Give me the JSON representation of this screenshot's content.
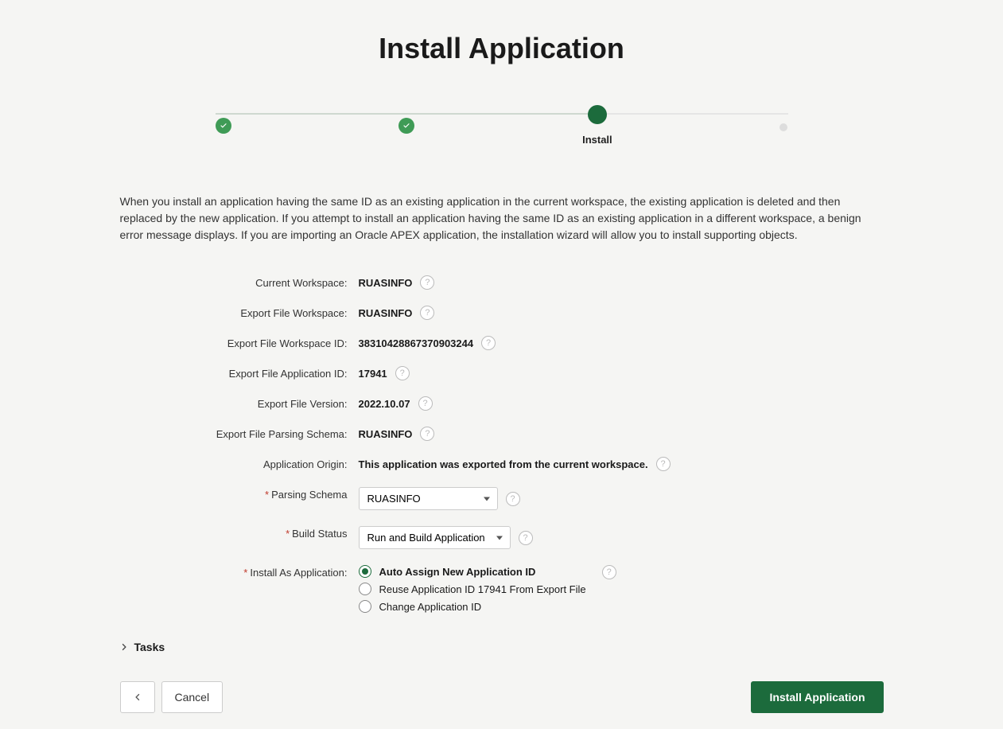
{
  "page_title": "Install Application",
  "steps": {
    "current_label": "Install"
  },
  "intro": "When you install an application having the same ID as an existing application in the current workspace, the existing application is deleted and then replaced by the new application. If you attempt to install an application having the same ID as an existing application in a different workspace, a benign error message displays. If you are importing an Oracle APEX application, the installation wizard will allow you to install supporting objects.",
  "fields": {
    "current_workspace": {
      "label": "Current Workspace:",
      "value": "RUASINFO"
    },
    "export_workspace": {
      "label": "Export File Workspace:",
      "value": "RUASINFO"
    },
    "export_workspace_id": {
      "label": "Export File Workspace ID:",
      "value": "38310428867370903244"
    },
    "export_app_id": {
      "label": "Export File Application ID:",
      "value": "17941"
    },
    "export_version": {
      "label": "Export File Version:",
      "value": "2022.10.07"
    },
    "export_parsing_schema": {
      "label": "Export File Parsing Schema:",
      "value": "RUASINFO"
    },
    "application_origin": {
      "label": "Application Origin:",
      "value": "This application was exported from the current workspace."
    },
    "parsing_schema": {
      "label": "Parsing Schema",
      "selected": "RUASINFO"
    },
    "build_status": {
      "label": "Build Status",
      "selected": "Run and Build Application"
    },
    "install_as": {
      "label": "Install As Application:",
      "options": {
        "auto": "Auto Assign New Application ID",
        "reuse": "Reuse Application ID 17941 From Export File",
        "change": "Change Application ID"
      }
    }
  },
  "tasks_label": "Tasks",
  "buttons": {
    "previous": "‹",
    "cancel": "Cancel",
    "install": "Install Application"
  }
}
